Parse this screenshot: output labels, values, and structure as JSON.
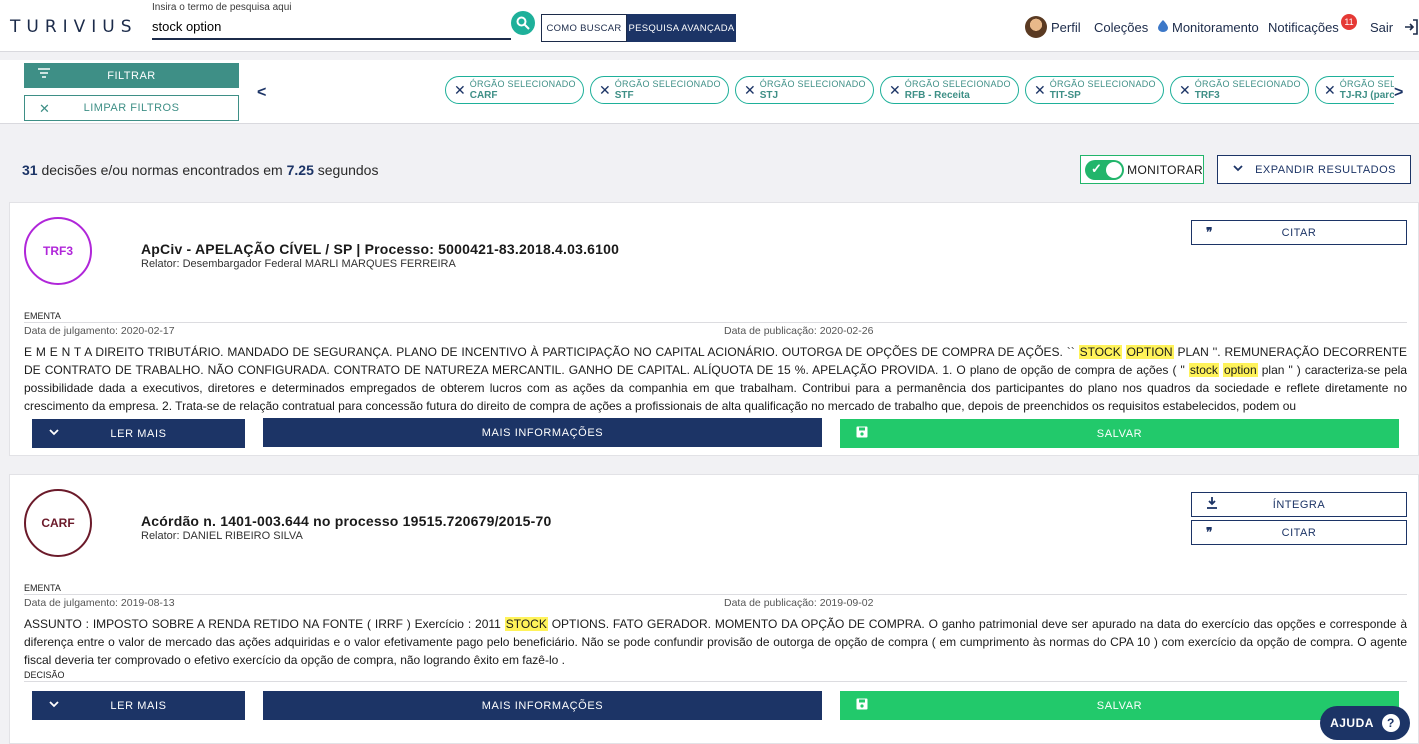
{
  "header": {
    "logo_text": "TURIVIUS",
    "search_label": "Insira o termo de pesquisa aqui",
    "search_value": "stock option",
    "how_to_search": "COMO BUSCAR",
    "advanced_search": "PESQUISA AVANÇADA",
    "nav": {
      "profile": "Perfil",
      "collections": "Coleções",
      "monitoring": "Monitoramento",
      "notifications": "Notificações",
      "notifications_count": "11",
      "logout": "Sair"
    }
  },
  "filters": {
    "filter_button": "FILTRAR",
    "clear_button": "LIMPAR FILTROS",
    "prev_arrow": "<",
    "next_arrow": ">",
    "chip_caption": "ÓRGÃO SELECIONADO",
    "chips": [
      {
        "label": "CARF"
      },
      {
        "label": "STF"
      },
      {
        "label": "STJ"
      },
      {
        "label": "RFB - Receita"
      },
      {
        "label": "TIT-SP"
      },
      {
        "label": "TRF3"
      },
      {
        "label": "TJ-RJ (parc"
      }
    ]
  },
  "results": {
    "count": "31",
    "text_a": " decisões e/ou normas encontrados em ",
    "time": "7.25",
    "text_b": " segundos",
    "monitor_label": "MONITORAR",
    "expand_label": "EXPANDIR RESULTADOS"
  },
  "cards": [
    {
      "court": "TRF3",
      "title": "ApCiv - APELAÇÃO CÍVEL / SP | Processo: 5000421-83.2018.4.03.6100",
      "relator": "Relator: Desembargador Federal MARLI MARQUES FERREIRA",
      "cite_label": "CITAR",
      "section": "EMENTA",
      "judgment_date": "Data de julgamento: 2020-02-17",
      "publication_date": "Data de publicação: 2020-02-26",
      "text_1": "E M E N T A DIREITO TRIBUTÁRIO. MANDADO DE SEGURANÇA. PLANO DE INCENTIVO À PARTICIPAÇÃO NO CAPITAL ACIONÁRIO. OUTORGA DE OPÇÕES DE COMPRA DE AÇÕES. `` ",
      "hl_1": "STOCK",
      "hl_2": "OPTION",
      "text_2": " PLAN ''. REMUNERAÇÃO DECORRENTE DE CONTRATO DE TRABALHO. NÃO CONFIGURADA. CONTRATO DE NATUREZA MERCANTIL. GANHO DE CAPITAL. ALÍQUOTA DE 15 %. APELAÇÃO PROVIDA. 1. O plano de opção de compra de ações ( \" ",
      "hl_3": "stock",
      "hl_4": "option",
      "text_3": " plan \" ) caracteriza-se pela possibilidade dada a executivos, diretores e determinados empregados de obterem lucros com as ações da companhia em que trabalham. Contribui para a permanência dos participantes do plano nos quadros da sociedade e reflete diretamente no crescimento da empresa. 2. Trata-se de relação contratual para concessão futura do direito de compra de ações a profissionais de alta qualificação no mercado de trabalho que, depois de preenchidos os requisitos estabelecidos, podem ou",
      "read_more": "LER MAIS",
      "more_info": "MAIS INFORMAÇÕES",
      "save": "SALVAR"
    },
    {
      "court": "CARF",
      "title": "Acórdão n. 1401-003.644 no processo 19515.720679/2015-70",
      "relator": "Relator: DANIEL RIBEIRO SILVA",
      "full_label": "ÍNTEGRA",
      "cite_label": "CITAR",
      "section": "EMENTA",
      "judgment_date": "Data de julgamento: 2019-08-13",
      "publication_date": "Data de publicação: 2019-09-02",
      "text_1": "ASSUNTO : IMPOSTO SOBRE A RENDA RETIDO NA FONTE ( IRRF ) Exercício : 2011 ",
      "hl_1": "STOCK",
      "text_2": " OPTIONS. FATO GERADOR. MOMENTO DA OPÇÃO DE COMPRA. O ganho patrimonial deve ser apurado na data do exercício das opções e corresponde à diferença entre o valor de mercado das ações adquiridas e o valor efetivamente pago pelo beneficiário. Não se pode confundir provisão de outorga de opção de compra ( em cumprimento às normas do CPA 10 ) com exercício da opção de compra. O agente fiscal deveria ter comprovado o efetivo exercício da opção de compra, não logrando êxito em fazê-lo .",
      "section_2": "DECISÃO",
      "read_more": "LER MAIS",
      "more_info": "MAIS INFORMAÇÕES",
      "save": "SALVAR"
    }
  ],
  "help": "AJUDA",
  "colors": {
    "navy": "#1c3466",
    "teal": "#3e8f86",
    "green": "#22c96b",
    "highlight": "#fff35a",
    "trf3_purple": "#b026d9",
    "carf_maroon": "#6b1a2a"
  }
}
